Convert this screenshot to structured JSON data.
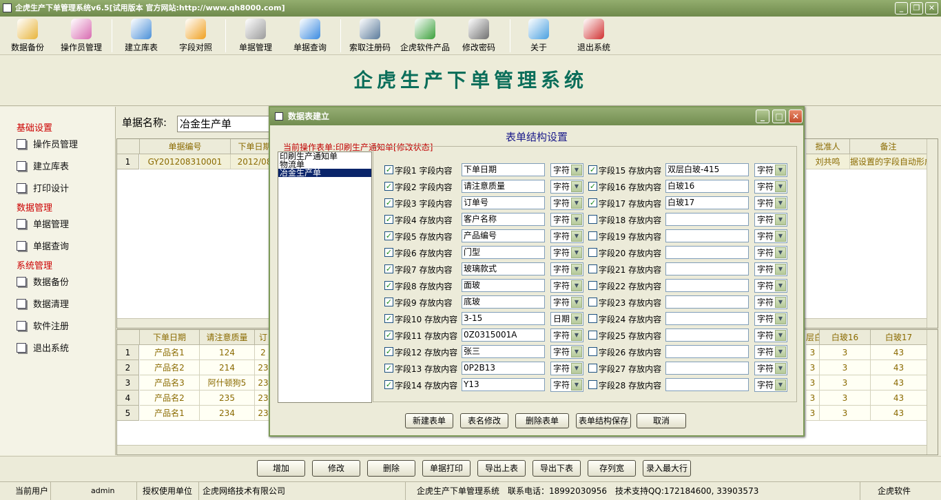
{
  "window": {
    "title": "企虎生产下单管理系统v6.5[试用版本 官方网站:http://www.qh8000.com]"
  },
  "toolbar": {
    "items": [
      {
        "label": "数据备份",
        "icon": "database-backup-icon",
        "color": "#e8b43a"
      },
      {
        "label": "操作员管理",
        "icon": "operator-icon",
        "color": "#d86ab0"
      },
      {
        "label": "建立库表",
        "icon": "pencil-table-icon",
        "color": "#4a8fd8"
      },
      {
        "label": "字段对照",
        "icon": "amazon-a-icon",
        "color": "#f0a020"
      },
      {
        "label": "单据管理",
        "icon": "magnifier-icon",
        "color": "#9a9a9a"
      },
      {
        "label": "单据查询",
        "icon": "query-icon",
        "color": "#3a8ae0"
      },
      {
        "label": "索取注册码",
        "icon": "monitor-icon",
        "color": "#5a7a9a"
      },
      {
        "label": "企虎软件产品",
        "icon": "refresh-icon",
        "color": "#3aa03a"
      },
      {
        "label": "修改密码",
        "icon": "key-icon",
        "color": "#707070"
      },
      {
        "label": "关于",
        "icon": "help-chat-icon",
        "color": "#4aa0e0"
      },
      {
        "label": "退出系统",
        "icon": "exit-cube-icon",
        "color": "#d03030"
      }
    ]
  },
  "banner": {
    "title": "企虎生产下单管理系统"
  },
  "sidebar": {
    "sections": [
      {
        "title": "基础设置",
        "items": [
          "操作员管理",
          "建立库表",
          "打印设计"
        ]
      },
      {
        "title": "数据管理",
        "items": [
          "单据管理",
          "单据查询"
        ]
      },
      {
        "title": "系统管理",
        "items": [
          "数据备份",
          "数据清理",
          "软件注册",
          "退出系统"
        ]
      }
    ]
  },
  "main": {
    "doc_name_label": "单据名称:",
    "doc_name_value": "冶金生产单",
    "top_grid": {
      "headers": [
        "单据编号",
        "下单日期"
      ],
      "right_headers": [
        "批准人",
        "备注"
      ],
      "row": {
        "num": "1",
        "cells": [
          "GY201208310001",
          "2012/08"
        ],
        "right_cells": [
          "刘共鸣",
          "据设置的字段自动形成"
        ]
      }
    },
    "bottom_grid": {
      "headers": [
        "下单日期",
        "请注意质量",
        "订"
      ],
      "right_headers": [
        "层白",
        "白玻16",
        "白玻17"
      ],
      "rows": [
        {
          "num": "1",
          "cells": [
            "产品名1",
            "124",
            "2"
          ],
          "right": [
            "3",
            "3",
            "43"
          ]
        },
        {
          "num": "2",
          "cells": [
            "产品名2",
            "214",
            "23"
          ],
          "right": [
            "3",
            "3",
            "43"
          ]
        },
        {
          "num": "3",
          "cells": [
            "产品名3",
            "阿什顿狗5",
            "23"
          ],
          "right": [
            "3",
            "3",
            "43"
          ]
        },
        {
          "num": "4",
          "cells": [
            "产品名2",
            "235",
            "23"
          ],
          "right": [
            "3",
            "3",
            "43"
          ]
        },
        {
          "num": "5",
          "cells": [
            "产品名1",
            "234",
            "23"
          ],
          "right": [
            "3",
            "3",
            "43"
          ]
        }
      ]
    }
  },
  "bottom_buttons": [
    "增加",
    "修改",
    "删除",
    "单据打印",
    "导出上表",
    "导出下表",
    "存列宽",
    "录入最大行"
  ],
  "statusbar": {
    "user_label": "当前用户",
    "user": "admin",
    "unit_label": "授权使用单位",
    "unit": "企虎网络技术有限公司",
    "info": "企虎生产下单管理系统　联系电话：18992030956　技术支持QQ:172184600, 33903573",
    "brand": "企虎软件"
  },
  "dialog": {
    "title": "数据表建立",
    "heading": "表单结构设置",
    "current": "当前操作表单:印刷生产通知单[修改状态]",
    "tables": [
      {
        "name": "印刷生产通知单",
        "selected": false
      },
      {
        "name": "物流单",
        "selected": false
      },
      {
        "name": "冶金生产单",
        "selected": true
      }
    ],
    "fields_left": [
      {
        "label": "字段1 字段内容",
        "checked": true,
        "value": "下单日期",
        "type": "字符"
      },
      {
        "label": "字段2 字段内容",
        "checked": true,
        "value": "请注意质量",
        "type": "字符"
      },
      {
        "label": "字段3 字段内容",
        "checked": true,
        "value": "订单号",
        "type": "字符"
      },
      {
        "label": "字段4 存放内容",
        "checked": true,
        "value": "客户名称",
        "type": "字符"
      },
      {
        "label": "字段5 存放内容",
        "checked": true,
        "value": "产品编号",
        "type": "字符"
      },
      {
        "label": "字段6 存放内容",
        "checked": true,
        "value": "门型",
        "type": "字符"
      },
      {
        "label": "字段7 存放内容",
        "checked": true,
        "value": "玻璃款式",
        "type": "字符"
      },
      {
        "label": "字段8 存放内容",
        "checked": true,
        "value": "面玻",
        "type": "字符"
      },
      {
        "label": "字段9 存放内容",
        "checked": true,
        "value": "底玻",
        "type": "字符"
      },
      {
        "label": "字段10 存放内容",
        "checked": true,
        "value": "3-15",
        "type": "日期"
      },
      {
        "label": "字段11 存放内容",
        "checked": true,
        "value": "0Z0315001A",
        "type": "字符"
      },
      {
        "label": "字段12 存放内容",
        "checked": true,
        "value": "张三",
        "type": "字符"
      },
      {
        "label": "字段13 存放内容",
        "checked": true,
        "value": "0P2B13",
        "type": "字符"
      },
      {
        "label": "字段14 存放内容",
        "checked": true,
        "value": "Y13",
        "type": "字符"
      }
    ],
    "fields_right": [
      {
        "label": "字段15 存放内容",
        "checked": true,
        "value": "双层白玻-415",
        "type": "字符"
      },
      {
        "label": "字段16 存放内容",
        "checked": true,
        "value": "白玻16",
        "type": "字符"
      },
      {
        "label": "字段17 存放内容",
        "checked": true,
        "value": "白玻17",
        "type": "字符"
      },
      {
        "label": "字段18 存放内容",
        "checked": false,
        "value": "",
        "type": "字符"
      },
      {
        "label": "字段19 存放内容",
        "checked": false,
        "value": "",
        "type": "字符"
      },
      {
        "label": "字段20 存放内容",
        "checked": false,
        "value": "",
        "type": "字符"
      },
      {
        "label": "字段21 存放内容",
        "checked": false,
        "value": "",
        "type": "字符"
      },
      {
        "label": "字段22 存放内容",
        "checked": false,
        "value": "",
        "type": "字符"
      },
      {
        "label": "字段23 存放内容",
        "checked": false,
        "value": "",
        "type": "字符"
      },
      {
        "label": "字段24 存放内容",
        "checked": false,
        "value": "",
        "type": "字符"
      },
      {
        "label": "字段25 存放内容",
        "checked": false,
        "value": "",
        "type": "字符"
      },
      {
        "label": "字段26 存放内容",
        "checked": false,
        "value": "",
        "type": "字符"
      },
      {
        "label": "字段27 存放内容",
        "checked": false,
        "value": "",
        "type": "字符"
      },
      {
        "label": "字段28 存放内容",
        "checked": false,
        "value": "",
        "type": "字符"
      }
    ],
    "buttons": [
      "新建表单",
      "表名修改",
      "删除表单",
      "表单结构保存",
      "取消"
    ]
  }
}
